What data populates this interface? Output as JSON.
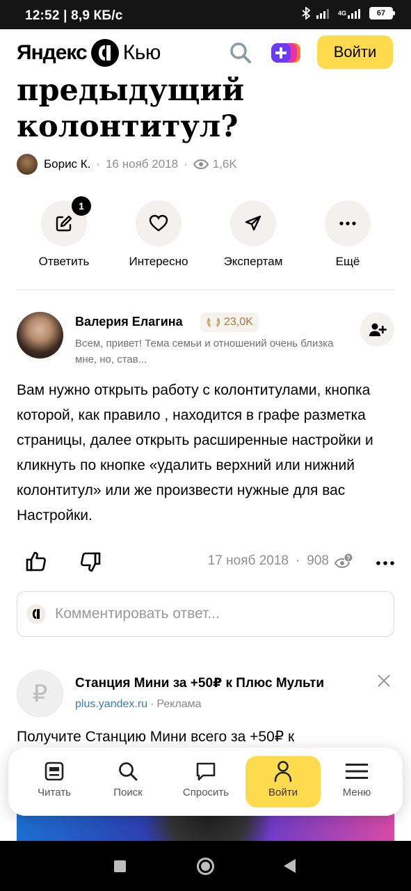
{
  "status_bar": {
    "time_speed": "12:52 | 8,9 КБ/с",
    "network": "4G",
    "battery": "67"
  },
  "header": {
    "logo_yandex": "Яндекс",
    "logo_service": "Кью",
    "login_label": "Войти",
    "colors": {
      "accent": "#ffdb4d"
    }
  },
  "question": {
    "title": "предыдущий колонтитул?",
    "author": "Борис К.",
    "date": "16 нояб 2018",
    "views": "1,6K"
  },
  "actions": {
    "answer_label": "Ответить",
    "answer_badge": "1",
    "interesting_label": "Интересно",
    "experts_label": "Экспертам",
    "more_label": "Ещё"
  },
  "answer": {
    "author": "Валерия Елагина",
    "rating": "23,0K",
    "bio": "Всем, привет! Тема семьи и отношений очень близка мне, но, став...",
    "text": "Вам нужно открыть работу с колонтитулами, кнопка которой, как правило , находится в графе разметка страницы, далее открыть расширенные настройки и кликнуть по кнопке «удалить верхний или нижний колонтитул» или же произвести нужные для вас Настройки.",
    "date": "17 нояб 2018",
    "views": "908"
  },
  "comment": {
    "placeholder": "Комментировать ответ..."
  },
  "ad": {
    "title": "Станция Мини за +50₽ к Плюс Мульти",
    "link": "plus.yandex.ru",
    "label": "Реклама",
    "text": "Получите Станцию Мини всего за +50₽ к",
    "logo_glyph": "₽"
  },
  "bottom_nav": {
    "items": [
      {
        "label": "Читать",
        "icon": "read-icon"
      },
      {
        "label": "Поиск",
        "icon": "search-icon"
      },
      {
        "label": "Спросить",
        "icon": "chat-icon"
      },
      {
        "label": "Войти",
        "icon": "user-icon",
        "active": true
      },
      {
        "label": "Меню",
        "icon": "menu-icon"
      }
    ]
  }
}
